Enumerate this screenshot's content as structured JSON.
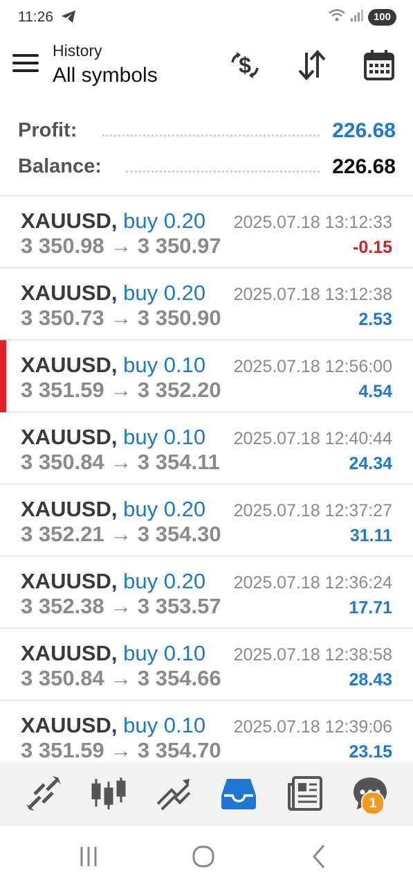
{
  "status_bar": {
    "time": "11:26",
    "battery": "100"
  },
  "header": {
    "subtitle": "History",
    "title": "All symbols"
  },
  "summary": {
    "profit_label": "Profit:",
    "profit_value": "226.68",
    "balance_label": "Balance:",
    "balance_value": "226.68"
  },
  "deals": [
    {
      "symbol": "XAUUSD,",
      "side": "buy 0.20",
      "prices": "3 350.98 → 3 350.97",
      "time": "2025.07.18 13:12:33",
      "profit": "-0.15",
      "negative": true,
      "marked": false
    },
    {
      "symbol": "XAUUSD,",
      "side": "buy 0.20",
      "prices": "3 350.73 → 3 350.90",
      "time": "2025.07.18 13:12:38",
      "profit": "2.53",
      "negative": false,
      "marked": false
    },
    {
      "symbol": "XAUUSD,",
      "side": "buy 0.10",
      "prices": "3 351.59 → 3 352.20",
      "time": "2025.07.18 12:56:00",
      "profit": "4.54",
      "negative": false,
      "marked": true
    },
    {
      "symbol": "XAUUSD,",
      "side": "buy 0.10",
      "prices": "3 350.84 → 3 354.11",
      "time": "2025.07.18 12:40:44",
      "profit": "24.34",
      "negative": false,
      "marked": false
    },
    {
      "symbol": "XAUUSD,",
      "side": "buy 0.20",
      "prices": "3 352.21 → 3 354.30",
      "time": "2025.07.18 12:37:27",
      "profit": "31.11",
      "negative": false,
      "marked": false
    },
    {
      "symbol": "XAUUSD,",
      "side": "buy 0.20",
      "prices": "3 352.38 → 3 353.57",
      "time": "2025.07.18 12:36:24",
      "profit": "17.71",
      "negative": false,
      "marked": false
    },
    {
      "symbol": "XAUUSD,",
      "side": "buy 0.10",
      "prices": "3 350.84 → 3 354.66",
      "time": "2025.07.18 12:38:58",
      "profit": "28.43",
      "negative": false,
      "marked": false
    },
    {
      "symbol": "XAUUSD,",
      "side": "buy 0.10",
      "prices": "3 351.59 → 3 354.70",
      "time": "2025.07.18 12:39:06",
      "profit": "23.15",
      "negative": false,
      "marked": false
    }
  ],
  "tabs": [
    {
      "name": "quotes-icon",
      "active": false
    },
    {
      "name": "chart-icon",
      "active": false
    },
    {
      "name": "trade-icon",
      "active": false
    },
    {
      "name": "history-icon",
      "active": true
    },
    {
      "name": "news-icon",
      "active": false
    },
    {
      "name": "chat-icon",
      "active": false
    }
  ],
  "chat_badge": "1",
  "colors": {
    "accent": "#1f77d4",
    "negative": "#d0202a",
    "marker": "#e0212b",
    "badge": "#f39a1e",
    "text_gray": "#8a8a8a"
  }
}
